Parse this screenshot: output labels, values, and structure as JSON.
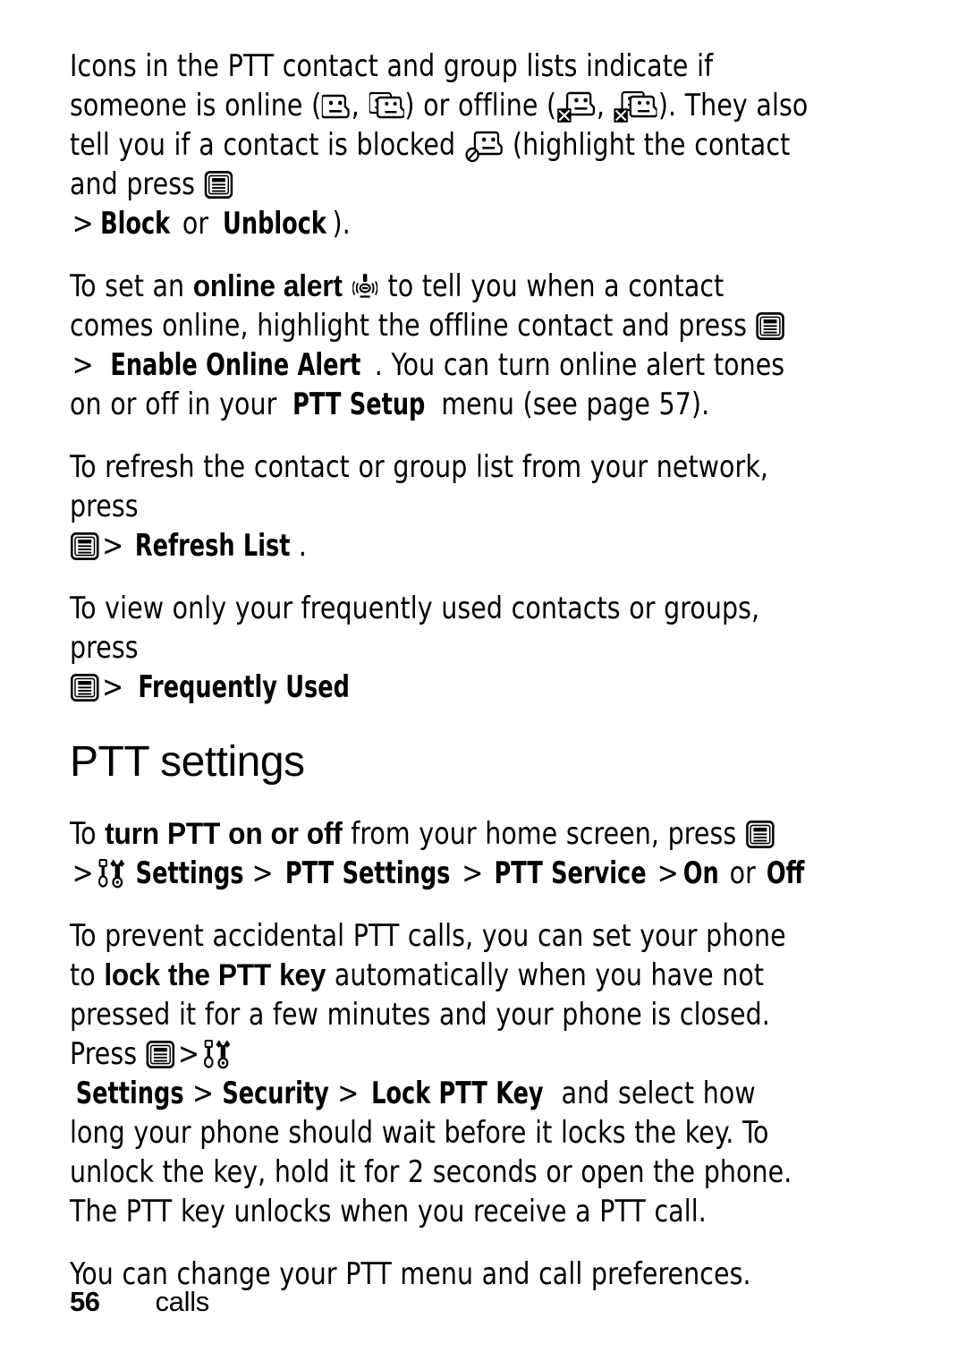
{
  "page": {
    "folio": "56",
    "running_head": "calls",
    "section_heading": "PTT settings"
  },
  "paragraphs": {
    "p1": {
      "t1": "Icons in the PTT contact and group lists indicate if someone is online (",
      "t2": ", ",
      "t3": ") or offline (",
      "t4": ", ",
      "t5": "). They also tell you if a contact is blocked ",
      "t6": " (highlight the contact and press ",
      "t7": " ",
      "gt": ">",
      "b_block": "Block",
      "t8": " or ",
      "b_unblock": "Unblock",
      "t9": ")."
    },
    "p2": {
      "t1": "To set an ",
      "b1": "online alert",
      "t2": " ",
      "t3": " to tell you when a contact comes online, highlight the offline contact and press ",
      "t4": " ",
      "gt": ">",
      "b2": "Enable Online Alert",
      "t5": ". You can turn online alert tones on or off in your ",
      "b3": "PTT Setup",
      "t6": " menu (see page 57)."
    },
    "p3": {
      "t1": "To refresh the contact or group list from your network, press ",
      "t2": " ",
      "gt": ">",
      "b1": "Refresh List",
      "t3": "."
    },
    "p4": {
      "t1": "To view only your frequently used contacts or groups, press ",
      "t2": " ",
      "gt": ">",
      "b1": "Frequently Used"
    },
    "p5": {
      "t1": "To ",
      "b1": "turn PTT on or off",
      "t2": " from your home screen, press ",
      "t3": " ",
      "gt1": ">",
      "b2": "Settings",
      "gt2": ">",
      "b3": "PTT Settings",
      "gt3": ">",
      "b4": "PTT Service",
      "gt4": ">",
      "b5": "On",
      "t4": " or ",
      "b6": "Off"
    },
    "p6": {
      "t1": "To prevent accidental PTT calls, you can set your phone to ",
      "b1": "lock the PTT key",
      "t2": " automatically when you have not pressed it for a few minutes and your phone is closed. Press ",
      "t3": " ",
      "gt1": ">",
      "b2": "Settings",
      "gt2": ">",
      "b3": "Security",
      "gt3": ">",
      "b4": "Lock PTT Key",
      "t4": " and select how long your phone should wait before it locks the key. To unlock the key, hold it for 2 seconds or open the phone. The PTT key unlocks when you receive a PTT call."
    },
    "p7": {
      "t1": "You can change your PTT menu and call preferences."
    }
  },
  "icons": {
    "menu_key": "menu-key-icon",
    "contact_online": "contact-online-face-icon",
    "group_online": "group-online-faces-icon",
    "contact_offline": "contact-offline-face-x-icon",
    "group_offline": "group-offline-faces-x-icon",
    "contact_blocked": "contact-blocked-face-icon",
    "online_alert": "online-alert-icon",
    "settings_tools": "settings-tools-icon"
  },
  "colors": {
    "ink": "#000000",
    "paper": "#ffffff"
  }
}
